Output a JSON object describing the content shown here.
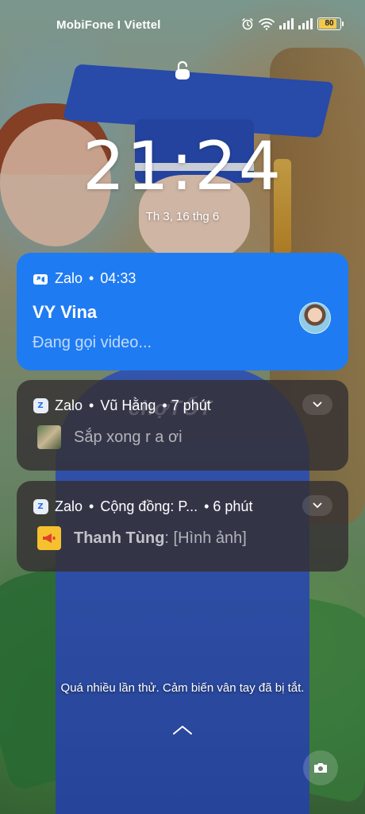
{
  "status_bar": {
    "carrier": "MobiFone I Viettel",
    "battery": "80",
    "icons": [
      "alarm-icon",
      "wifi-icon",
      "signal-icon",
      "signal-icon",
      "battery-icon"
    ]
  },
  "lock_screen": {
    "time": "21:24",
    "date": "Th 3, 16 thg 6",
    "fingerprint_message": "Quá nhiều lần thử. Cảm biến vân tay đã bị tắt."
  },
  "notifications": [
    {
      "app": "Zalo",
      "sep": "•",
      "meta": "04:33",
      "title": "VY Vina",
      "text": "Đang gọi video...",
      "color": "#1f7bf2"
    },
    {
      "app": "Zalo",
      "sep": "•",
      "meta": "Vũ Hằng",
      "time": "• 7 phút",
      "text": "Sắp xong r a ơi"
    },
    {
      "app": "Zalo",
      "sep": "•",
      "meta": "Cộng đồng: P...",
      "time": "• 6 phút",
      "sender": "Thanh Tùng",
      "text": ": [Hình ảnh]"
    }
  ],
  "watermark": "chợTỐT"
}
